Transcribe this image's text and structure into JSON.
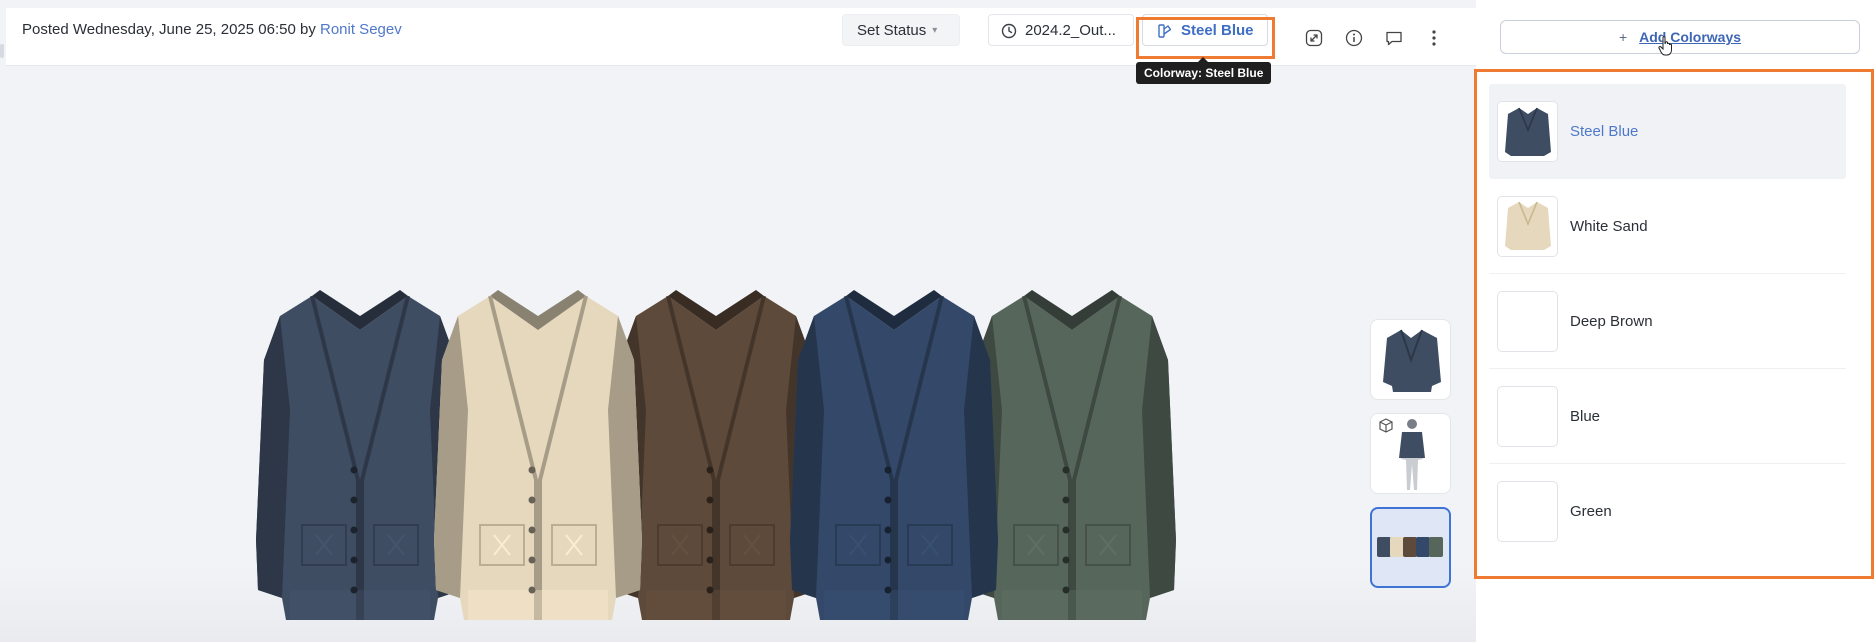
{
  "header": {
    "posted_prefix": "Posted Wednesday, June 25, 2025 06:50 by",
    "posted_user": "Ronit Segev",
    "status_label": "Set Status",
    "version_label": "2024.2_Out...",
    "colorway_label": "Steel Blue",
    "tooltip": "Colorway: Steel Blue"
  },
  "icons": {
    "version": "clock-icon",
    "colorway": "colorway-icon",
    "expand": "expand-icon",
    "info": "info-icon",
    "comment": "comment-icon",
    "more": "more-vertical-icon",
    "avatar_3d": "cube-icon"
  },
  "panel": {
    "add_button_plus": "+",
    "add_button_label": "Add Colorways",
    "colorways": [
      {
        "name": "Steel Blue",
        "selected": true
      },
      {
        "name": "White Sand",
        "selected": false
      },
      {
        "name": "Deep Brown",
        "selected": false
      },
      {
        "name": "Blue",
        "selected": false
      },
      {
        "name": "Green",
        "selected": false
      }
    ]
  },
  "garments": [
    {
      "colorway": "Steel Blue",
      "color": "#3f4d63"
    },
    {
      "colorway": "White Sand",
      "color": "#e6d8bd"
    },
    {
      "colorway": "Deep Brown",
      "color": "#5e4a3a"
    },
    {
      "colorway": "Blue",
      "color": "#34496a"
    },
    {
      "colorway": "Green",
      "color": "#56665b"
    }
  ],
  "colors": {
    "accent": "#3e6fc4",
    "highlight": "#ef7a31",
    "link": "#4f78c9"
  }
}
